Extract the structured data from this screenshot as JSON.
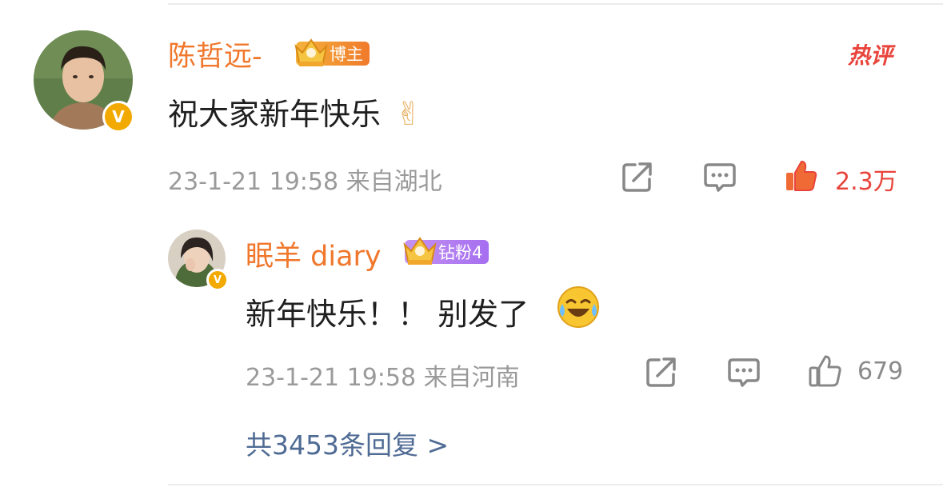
{
  "comment": {
    "author": "陈哲远-",
    "badge_label": "博主",
    "hot_tag": "热评",
    "text": "祝大家新年快乐",
    "emoji": "✌",
    "meta": "23-1-21 19:58  来自湖北",
    "like_count": "2.3万"
  },
  "reply": {
    "author": "眠羊 diary",
    "badge_label": "钻粉4",
    "text": "新年快乐！！ 别发了",
    "meta": "23-1-21 19:58  来自河南",
    "like_count": "679"
  },
  "more_replies": "共3453条回复 >",
  "colors": {
    "name": "#f0772c",
    "like_active": "#e8443b",
    "link": "#4f6b94",
    "meta": "#9a9a9a"
  }
}
